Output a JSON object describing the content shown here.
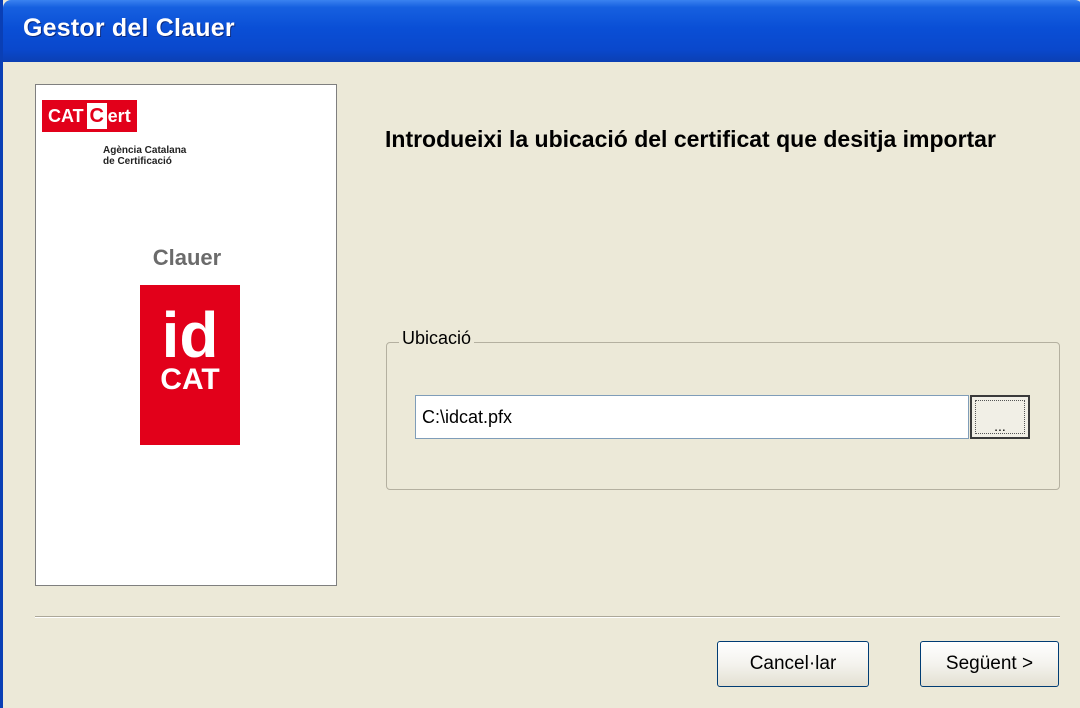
{
  "window": {
    "title": "Gestor del Clauer"
  },
  "side_panel": {
    "logo_cat": "CAT",
    "logo_c": "C",
    "logo_ert": "ert",
    "agency_line1": "Agència Catalana",
    "agency_line2": "de Certificació",
    "product_label": "Clauer",
    "idcat_id": "id",
    "idcat_cat": "CAT"
  },
  "main": {
    "heading": "Introdueixi la ubicació del certificat que desitja importar",
    "group_label": "Ubicació",
    "path_value": "C:\\idcat.pfx",
    "browse_label": "..."
  },
  "buttons": {
    "cancel": "Cancel·lar",
    "next": "Següent >"
  },
  "colors": {
    "brand_red": "#e2001a",
    "titlebar_blue": "#0a4fd6",
    "window_bg": "#ece9d8"
  }
}
